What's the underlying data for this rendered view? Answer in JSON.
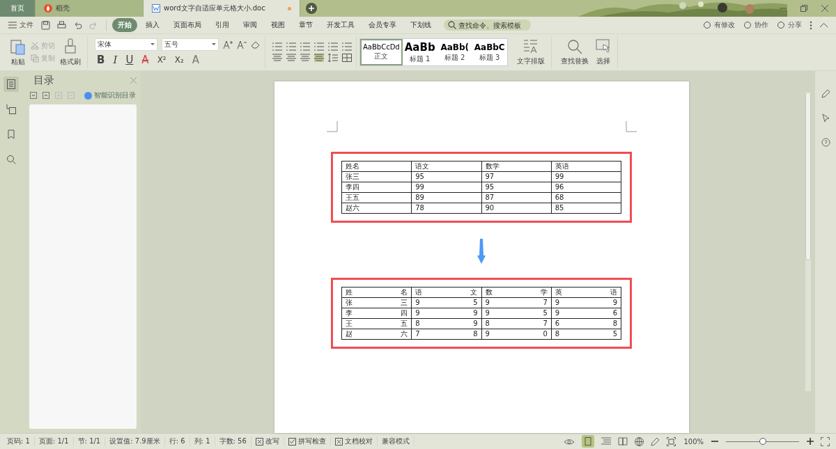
{
  "tabs": [
    {
      "label": "首页",
      "kind": "home",
      "selected": false
    },
    {
      "label": "稻壳",
      "kind": "docer",
      "selected": false
    },
    {
      "label": "word文字自适应单元格大小.doc",
      "kind": "doc",
      "selected": true,
      "modified": true
    }
  ],
  "menu": {
    "file": "文件",
    "items": [
      {
        "label": "开始",
        "selected": true
      },
      {
        "label": "插入",
        "selected": false
      },
      {
        "label": "页面布局",
        "selected": false
      },
      {
        "label": "引用",
        "selected": false
      },
      {
        "label": "审阅",
        "selected": false
      },
      {
        "label": "视图",
        "selected": false
      },
      {
        "label": "章节",
        "selected": false
      },
      {
        "label": "开发工具",
        "selected": false
      },
      {
        "label": "会员专享",
        "selected": false
      },
      {
        "label": "下划线",
        "selected": false
      }
    ],
    "search": {
      "placeholder": "查找命令、搜索模板"
    },
    "right": [
      "有修改",
      "协作",
      "分享"
    ]
  },
  "ribbon": {
    "paste": "粘贴",
    "cut": "剪切",
    "copy": "复制",
    "format_painter": "格式刷",
    "font": "宋体",
    "size": "五号",
    "format_keys": [
      "B",
      "I",
      "U",
      "A",
      "X²",
      "X₂",
      "A"
    ],
    "styles": [
      {
        "sample": "AaBbCcDd",
        "label": "正文",
        "selected": true,
        "kind": "body"
      },
      {
        "sample": "AaBb",
        "label": "标题 1",
        "selected": false,
        "kind": "h1"
      },
      {
        "sample": "AaBb(",
        "label": "标题 2",
        "selected": false,
        "kind": "h2"
      },
      {
        "sample": "AaBbC",
        "label": "标题 3",
        "selected": false,
        "kind": "h3"
      }
    ],
    "layout": "文字排版",
    "find": "查找替换",
    "select": "选择"
  },
  "outline": {
    "title": "目录",
    "smart": "智能识别目录"
  },
  "tables": [
    {
      "kind": "plain",
      "rows": [
        [
          "姓名",
          "语文",
          "数学",
          "英语"
        ],
        [
          "张三",
          "95",
          "97",
          "99"
        ],
        [
          "李四",
          "99",
          "95",
          "96"
        ],
        [
          "王五",
          "89",
          "87",
          "68"
        ],
        [
          "赵六",
          "78",
          "90",
          "85"
        ]
      ]
    },
    {
      "kind": "distributed",
      "rows": [
        [
          "姓 名",
          "语 文",
          "数 学",
          "英 语"
        ],
        [
          "张 三",
          "9 5",
          "9 7",
          "9 9"
        ],
        [
          "李 四",
          "9 9",
          "9 5",
          "9 6"
        ],
        [
          "王 五",
          "8 9",
          "8 7",
          "6 8"
        ],
        [
          "赵 六",
          "7 8",
          "9 0",
          "8 5"
        ]
      ]
    }
  ],
  "status": {
    "items": [
      "页码: 1",
      "页面: 1/1",
      "节: 1/1",
      "设置值: 7.9厘米",
      "行: 6",
      "列: 1",
      "字数: 56"
    ],
    "toggles": [
      {
        "label": "改写",
        "checked": false
      },
      {
        "label": "拼写检查",
        "checked": true
      },
      {
        "label": "文档校对",
        "checked": false
      }
    ],
    "mode": "兼容模式",
    "zoom": "100%",
    "level": 0.5
  }
}
